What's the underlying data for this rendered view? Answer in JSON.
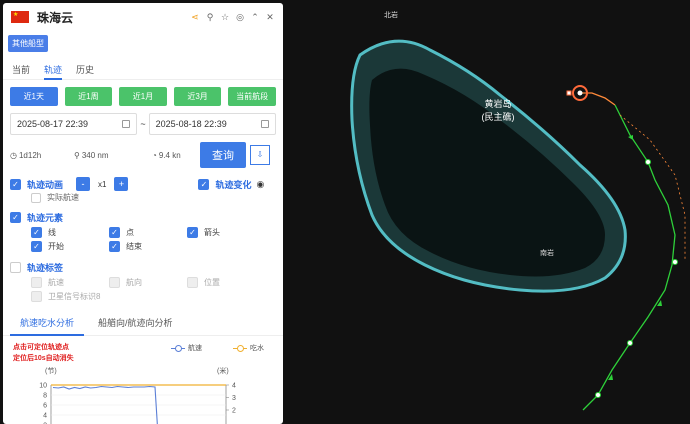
{
  "panel": {
    "vessel_name": "珠海云",
    "other_vessel_button": "其他船型",
    "tabs": [
      "当前",
      "轨迹",
      "历史"
    ],
    "active_tab": "轨迹",
    "range_buttons": [
      "近1天",
      "近1周",
      "近1月",
      "近3月",
      "当前航段"
    ],
    "start_date": "2025-08-17 22:39",
    "date_separator": "~",
    "end_date": "2025-08-18 22:39",
    "duration": "1d12h",
    "distance": "340 nm",
    "speed": "9.4 kn",
    "query_button": "查询",
    "track_animation": {
      "label": "轨迹动画",
      "minus": "-",
      "speed": "x1",
      "plus": "+",
      "actual_speed": "实际航速"
    },
    "track_change": "轨迹变化",
    "track_elements": {
      "label": "轨迹元素",
      "items": [
        "线",
        "点",
        "箭头",
        "开始",
        "结束"
      ]
    },
    "track_labels": {
      "label": "轨迹标签",
      "items": [
        "航速",
        "航向",
        "位置",
        "卫星信号标识8"
      ]
    },
    "analysis_tabs": [
      "航速吃水分析",
      "船艏向/航迹向分析"
    ],
    "note": [
      "点击可定位轨迹点",
      "定位后10s自动消失"
    ]
  },
  "chart_data": {
    "type": "line",
    "legend": [
      "航速",
      "吃水"
    ],
    "left_unit": "(节)",
    "right_unit": "(米)",
    "left_ticks": [
      "10",
      "8",
      "6",
      "4",
      "2"
    ],
    "right_ticks": [
      "4",
      "3",
      "2"
    ],
    "ylim_left": [
      0,
      10
    ],
    "ylim_right": [
      0,
      4
    ],
    "colors": {
      "speed": "#5b7fd6",
      "draft": "#f0b030"
    },
    "speed": [
      9.5,
      9.4,
      9.6,
      9.2,
      9.5,
      9.3,
      9.6,
      9.4,
      9.5,
      9.7,
      9.6,
      9.5,
      9.7,
      9.6,
      9.5,
      9.6,
      9.6,
      9.6,
      9.7,
      9.6,
      0.0
    ],
    "draft": [
      4,
      4,
      4,
      4,
      4,
      4,
      4,
      4,
      4,
      4,
      4,
      4,
      4,
      4,
      4,
      4,
      4,
      4,
      4,
      4,
      4
    ]
  },
  "map": {
    "labels": {
      "north_rock": "北岩",
      "island": "黄岩岛",
      "island_alt": "(民主礁)",
      "south_rock": "南岩"
    },
    "colors": {
      "track": "#2ed13a",
      "current_position": "#ff6a3a",
      "land": "#1a3a3a",
      "reef": "#5bd0d8"
    }
  },
  "colors": {
    "accent": "#3d7be6",
    "green_button": "#4bc36a"
  }
}
